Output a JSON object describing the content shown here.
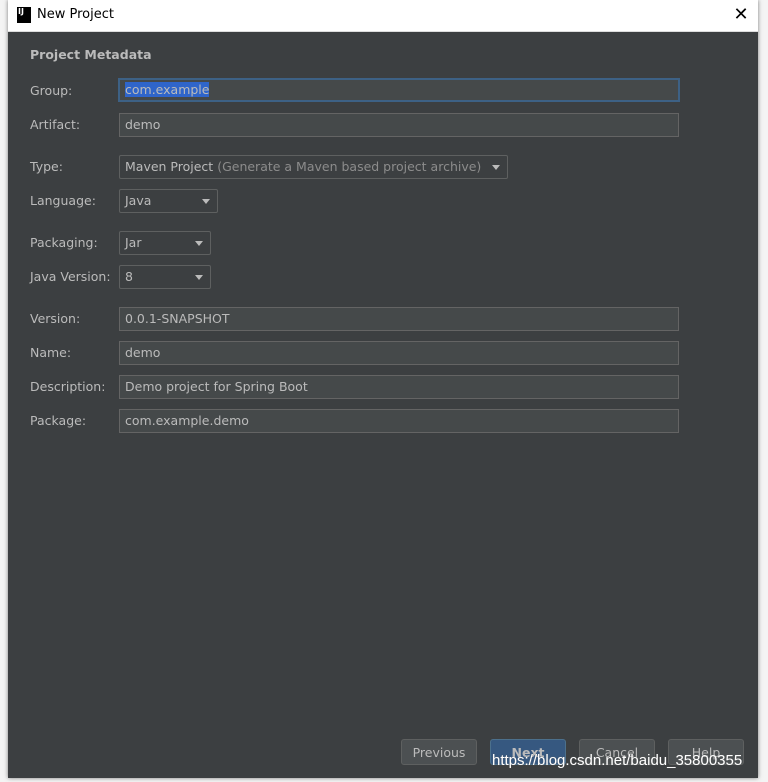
{
  "window": {
    "title": "New Project",
    "close_icon": "close-icon"
  },
  "section_title": "Project Metadata",
  "fields": {
    "group": {
      "label": "Group:",
      "value": "com.example"
    },
    "artifact": {
      "label": "Artifact:",
      "value": "demo"
    },
    "type": {
      "label": "Type:",
      "value": "Maven Project",
      "hint": "(Generate a Maven based project archive)"
    },
    "language": {
      "label": "Language:",
      "value": "Java"
    },
    "packaging": {
      "label": "Packaging:",
      "value": "Jar"
    },
    "java_version": {
      "label": "Java Version:",
      "value": "8"
    },
    "version": {
      "label": "Version:",
      "value": "0.0.1-SNAPSHOT"
    },
    "name": {
      "label": "Name:",
      "value": "demo"
    },
    "description": {
      "label": "Description:",
      "value": "Demo project for Spring Boot"
    },
    "package": {
      "label": "Package:",
      "value": "com.example.demo"
    }
  },
  "buttons": {
    "previous": "Previous",
    "next": "Next",
    "cancel": "Cancel",
    "help": "Help"
  },
  "watermark": "https://blog.csdn.net/baidu_35800355"
}
